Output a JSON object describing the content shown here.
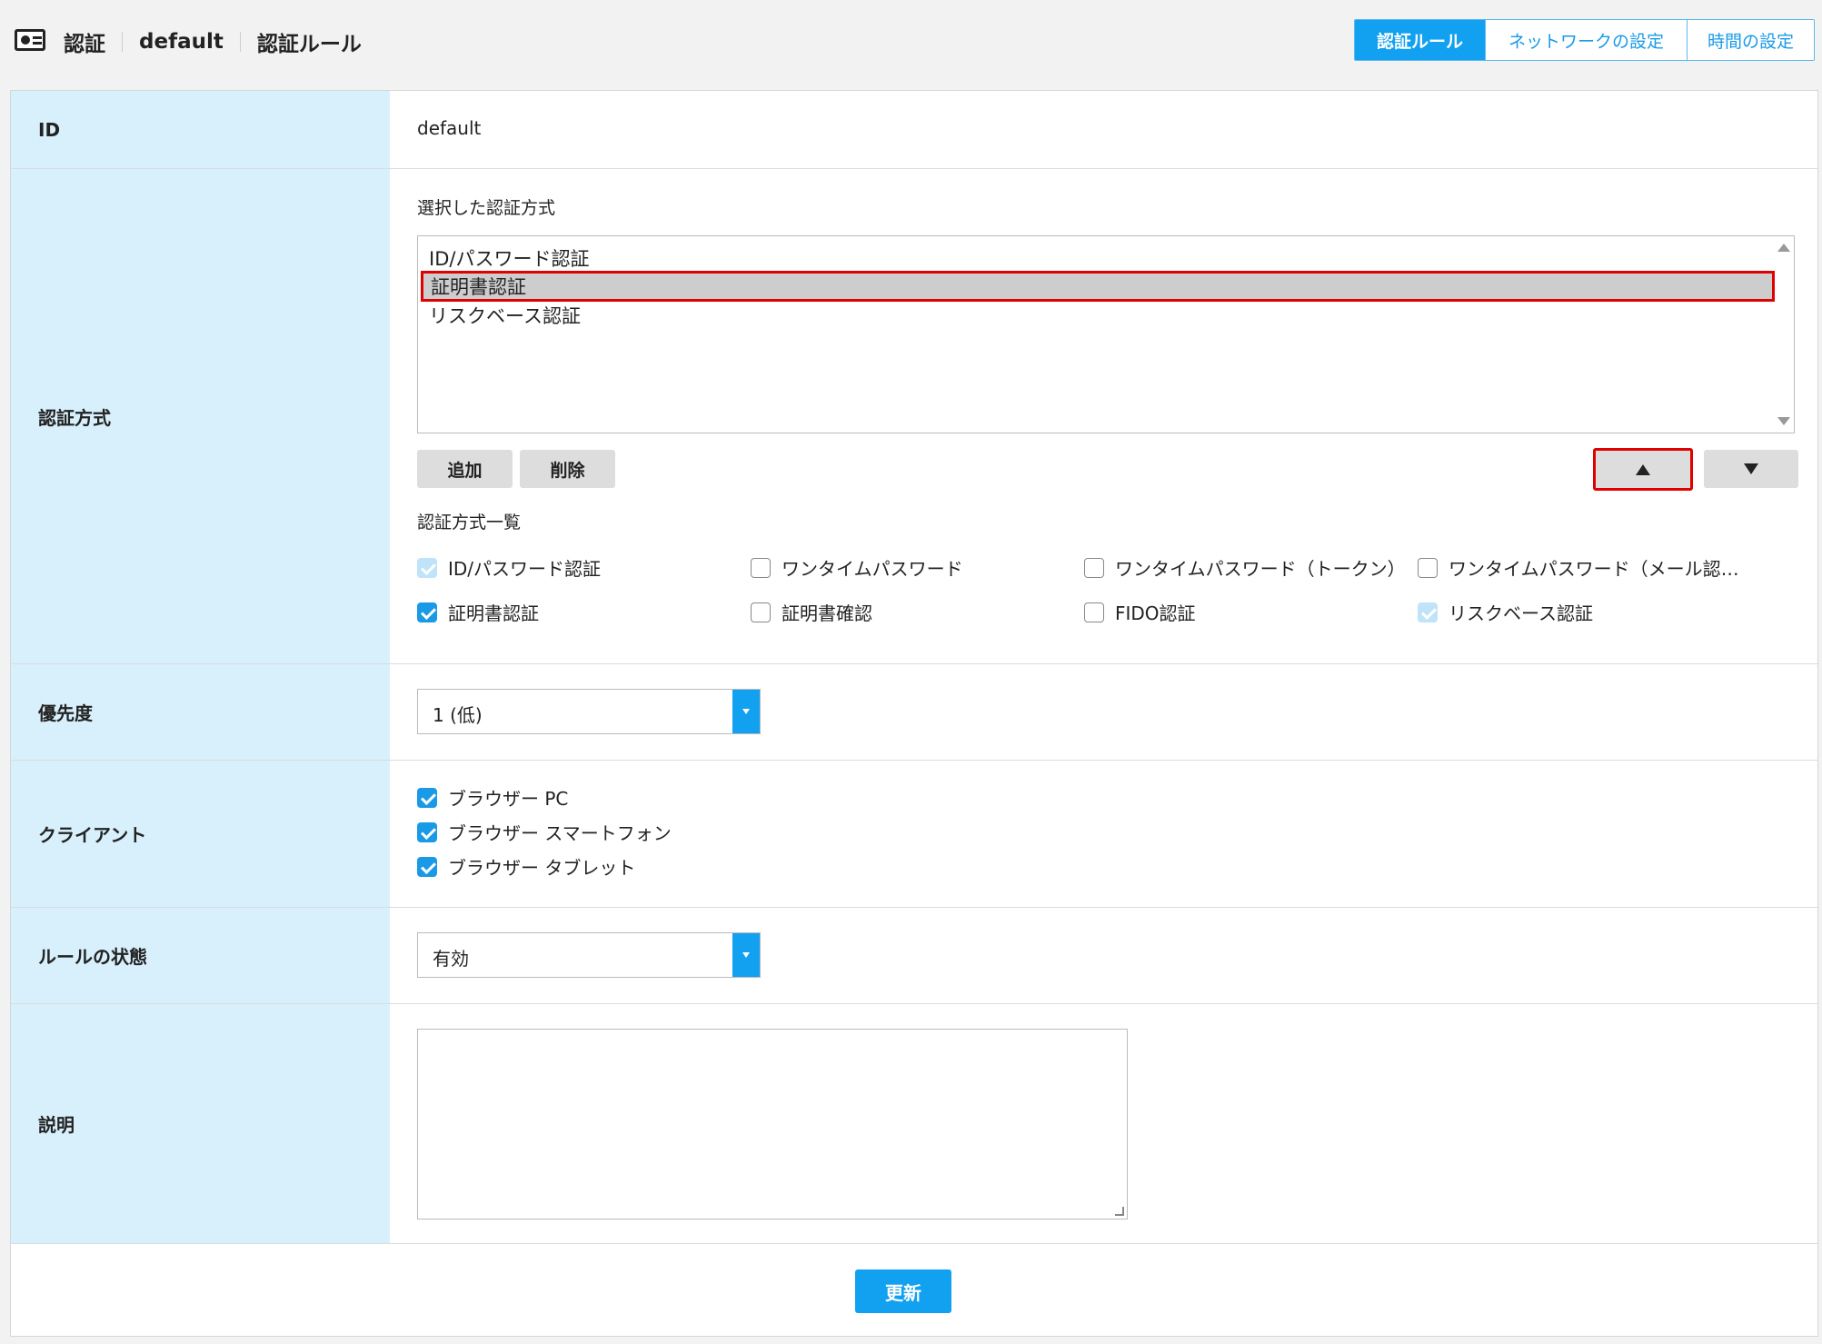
{
  "header": {
    "crumbs": [
      "認証",
      "default",
      "認証ルール"
    ],
    "tabs": [
      "認証ルール",
      "ネットワークの設定",
      "時間の設定"
    ]
  },
  "form": {
    "id": {
      "label": "ID",
      "value": "default"
    },
    "auth": {
      "label": "認証方式",
      "selected_heading": "選択した認証方式",
      "selected_list": [
        "ID/パスワード認証",
        "証明書認証",
        "リスクベース認証"
      ],
      "add_button": "追加",
      "delete_button": "削除",
      "catalog_heading": "認証方式一覧",
      "catalog": [
        {
          "label": "ID/パスワード認証",
          "state": "checked-disabled"
        },
        {
          "label": "ワンタイムパスワード",
          "state": "unchecked"
        },
        {
          "label": "ワンタイムパスワード（トークン）",
          "state": "unchecked"
        },
        {
          "label": "ワンタイムパスワード（メール認…",
          "state": "unchecked"
        },
        {
          "label": "証明書認証",
          "state": "checked"
        },
        {
          "label": "証明書確認",
          "state": "unchecked"
        },
        {
          "label": "FIDO認証",
          "state": "unchecked"
        },
        {
          "label": "リスクベース認証",
          "state": "checked-disabled"
        }
      ]
    },
    "priority": {
      "label": "優先度",
      "value": "1 (低)"
    },
    "client": {
      "label": "クライアント",
      "options": [
        "ブラウザー PC",
        "ブラウザー スマートフォン",
        "ブラウザー タブレット"
      ]
    },
    "rule_state": {
      "label": "ルールの状態",
      "value": "有効"
    },
    "description": {
      "label": "説明",
      "value": ""
    },
    "update_button": "更新"
  },
  "colors": {
    "accent": "#12a0f0",
    "label_bg": "#d8f0fc",
    "highlight": "#e00000"
  }
}
